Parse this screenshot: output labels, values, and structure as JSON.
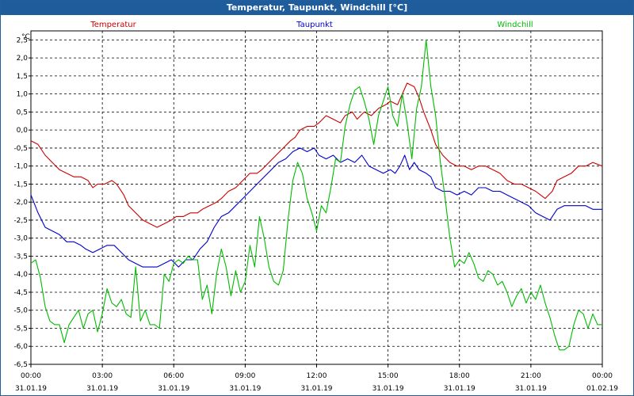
{
  "window": {
    "title": "Temperatur, Taupunkt, Windchill [°C]"
  },
  "chart_data": {
    "type": "line",
    "title": "Temperatur, Taupunkt, Windchill [°C]",
    "ylabel": "°C",
    "xlabel": "",
    "ylim": [
      -6.5,
      2.75
    ],
    "xlim": [
      0,
      24
    ],
    "yticks": [
      2.5,
      2.0,
      1.5,
      1.0,
      0.5,
      0.0,
      -0.5,
      -1.0,
      -1.5,
      -2.0,
      -2.5,
      -3.0,
      -3.5,
      -4.0,
      -4.5,
      -5.0,
      -5.5,
      -6.0,
      -6.5
    ],
    "ytick_labels": [
      "2,5",
      "2,0",
      "1,5",
      "1,0",
      "0,5",
      "0,0",
      "-0,5",
      "-1,0",
      "-1,5",
      "-2,0",
      "-2,5",
      "-3,0",
      "-3,5",
      "-4,0",
      "-4,5",
      "-5,0",
      "-5,5",
      "-6,0",
      "-6,5"
    ],
    "xticks": [
      {
        "time": "00:00",
        "date": "31.01.19"
      },
      {
        "time": "03:00",
        "date": "31.01.19"
      },
      {
        "time": "06:00",
        "date": "31.01.19"
      },
      {
        "time": "09:00",
        "date": "31.01.19"
      },
      {
        "time": "12:00",
        "date": "31.01.19"
      },
      {
        "time": "15:00",
        "date": "31.01.19"
      },
      {
        "time": "18:00",
        "date": "31.01.19"
      },
      {
        "time": "21:00",
        "date": "31.01.19"
      },
      {
        "time": "00:00",
        "date": "01.02.19"
      }
    ],
    "grid": true,
    "legend_position": "top",
    "series": [
      {
        "name": "Temperatur",
        "color": "#cc0000",
        "points": [
          [
            0.0,
            -0.3
          ],
          [
            0.3,
            -0.4
          ],
          [
            0.6,
            -0.7
          ],
          [
            0.9,
            -0.9
          ],
          [
            1.2,
            -1.1
          ],
          [
            1.5,
            -1.2
          ],
          [
            1.8,
            -1.3
          ],
          [
            2.1,
            -1.3
          ],
          [
            2.4,
            -1.4
          ],
          [
            2.6,
            -1.6
          ],
          [
            2.8,
            -1.5
          ],
          [
            3.1,
            -1.5
          ],
          [
            3.4,
            -1.4
          ],
          [
            3.6,
            -1.5
          ],
          [
            3.9,
            -1.8
          ],
          [
            4.1,
            -2.1
          ],
          [
            4.4,
            -2.3
          ],
          [
            4.7,
            -2.5
          ],
          [
            5.0,
            -2.6
          ],
          [
            5.3,
            -2.7
          ],
          [
            5.6,
            -2.6
          ],
          [
            5.9,
            -2.5
          ],
          [
            6.1,
            -2.4
          ],
          [
            6.4,
            -2.4
          ],
          [
            6.7,
            -2.3
          ],
          [
            7.0,
            -2.3
          ],
          [
            7.2,
            -2.2
          ],
          [
            7.5,
            -2.1
          ],
          [
            7.8,
            -2.0
          ],
          [
            8.0,
            -1.9
          ],
          [
            8.3,
            -1.7
          ],
          [
            8.6,
            -1.6
          ],
          [
            8.9,
            -1.4
          ],
          [
            9.2,
            -1.2
          ],
          [
            9.5,
            -1.2
          ],
          [
            9.7,
            -1.1
          ],
          [
            10.0,
            -0.9
          ],
          [
            10.3,
            -0.7
          ],
          [
            10.6,
            -0.5
          ],
          [
            10.9,
            -0.3
          ],
          [
            11.1,
            -0.2
          ],
          [
            11.3,
            0.0
          ],
          [
            11.6,
            0.1
          ],
          [
            11.9,
            0.1
          ],
          [
            12.1,
            0.2
          ],
          [
            12.4,
            0.4
          ],
          [
            12.7,
            0.3
          ],
          [
            13.0,
            0.2
          ],
          [
            13.2,
            0.4
          ],
          [
            13.5,
            0.5
          ],
          [
            13.7,
            0.3
          ],
          [
            14.0,
            0.5
          ],
          [
            14.3,
            0.4
          ],
          [
            14.6,
            0.6
          ],
          [
            14.9,
            0.7
          ],
          [
            15.1,
            0.8
          ],
          [
            15.4,
            0.7
          ],
          [
            15.6,
            1.0
          ],
          [
            15.8,
            1.3
          ],
          [
            16.1,
            1.2
          ],
          [
            16.3,
            0.9
          ],
          [
            16.5,
            0.5
          ],
          [
            16.8,
            0.0
          ],
          [
            17.0,
            -0.4
          ],
          [
            17.3,
            -0.7
          ],
          [
            17.6,
            -0.9
          ],
          [
            17.9,
            -1.0
          ],
          [
            18.2,
            -1.0
          ],
          [
            18.5,
            -1.1
          ],
          [
            18.8,
            -1.0
          ],
          [
            19.1,
            -1.0
          ],
          [
            19.4,
            -1.1
          ],
          [
            19.7,
            -1.2
          ],
          [
            20.0,
            -1.4
          ],
          [
            20.3,
            -1.5
          ],
          [
            20.6,
            -1.5
          ],
          [
            20.9,
            -1.6
          ],
          [
            21.2,
            -1.7
          ],
          [
            21.4,
            -1.8
          ],
          [
            21.6,
            -1.9
          ],
          [
            21.9,
            -1.7
          ],
          [
            22.1,
            -1.4
          ],
          [
            22.4,
            -1.3
          ],
          [
            22.7,
            -1.2
          ],
          [
            23.0,
            -1.0
          ],
          [
            23.3,
            -1.0
          ],
          [
            23.6,
            -0.9
          ],
          [
            24.0,
            -1.0
          ]
        ]
      },
      {
        "name": "Taupunkt",
        "color": "#0000cc",
        "points": [
          [
            0.0,
            -1.8
          ],
          [
            0.3,
            -2.3
          ],
          [
            0.6,
            -2.7
          ],
          [
            0.9,
            -2.8
          ],
          [
            1.2,
            -2.9
          ],
          [
            1.5,
            -3.1
          ],
          [
            1.8,
            -3.1
          ],
          [
            2.1,
            -3.2
          ],
          [
            2.3,
            -3.3
          ],
          [
            2.6,
            -3.4
          ],
          [
            2.9,
            -3.3
          ],
          [
            3.2,
            -3.2
          ],
          [
            3.5,
            -3.2
          ],
          [
            3.8,
            -3.4
          ],
          [
            4.1,
            -3.6
          ],
          [
            4.4,
            -3.7
          ],
          [
            4.7,
            -3.8
          ],
          [
            5.0,
            -3.8
          ],
          [
            5.3,
            -3.8
          ],
          [
            5.6,
            -3.7
          ],
          [
            5.9,
            -3.6
          ],
          [
            6.2,
            -3.8
          ],
          [
            6.5,
            -3.6
          ],
          [
            6.8,
            -3.6
          ],
          [
            7.1,
            -3.3
          ],
          [
            7.4,
            -3.1
          ],
          [
            7.7,
            -2.7
          ],
          [
            8.0,
            -2.4
          ],
          [
            8.3,
            -2.3
          ],
          [
            8.6,
            -2.1
          ],
          [
            8.9,
            -1.9
          ],
          [
            9.2,
            -1.7
          ],
          [
            9.5,
            -1.5
          ],
          [
            9.8,
            -1.3
          ],
          [
            10.1,
            -1.1
          ],
          [
            10.4,
            -0.9
          ],
          [
            10.7,
            -0.8
          ],
          [
            11.0,
            -0.6
          ],
          [
            11.3,
            -0.5
          ],
          [
            11.6,
            -0.6
          ],
          [
            11.9,
            -0.5
          ],
          [
            12.1,
            -0.7
          ],
          [
            12.4,
            -0.8
          ],
          [
            12.7,
            -0.7
          ],
          [
            13.0,
            -0.9
          ],
          [
            13.3,
            -0.8
          ],
          [
            13.6,
            -0.9
          ],
          [
            13.9,
            -0.7
          ],
          [
            14.2,
            -1.0
          ],
          [
            14.5,
            -1.1
          ],
          [
            14.8,
            -1.2
          ],
          [
            15.1,
            -1.1
          ],
          [
            15.3,
            -1.2
          ],
          [
            15.5,
            -1.0
          ],
          [
            15.7,
            -0.7
          ],
          [
            15.9,
            -1.1
          ],
          [
            16.1,
            -0.9
          ],
          [
            16.3,
            -1.1
          ],
          [
            16.6,
            -1.2
          ],
          [
            16.8,
            -1.3
          ],
          [
            17.0,
            -1.6
          ],
          [
            17.3,
            -1.7
          ],
          [
            17.6,
            -1.7
          ],
          [
            17.9,
            -1.8
          ],
          [
            18.2,
            -1.7
          ],
          [
            18.5,
            -1.8
          ],
          [
            18.8,
            -1.6
          ],
          [
            19.1,
            -1.6
          ],
          [
            19.4,
            -1.7
          ],
          [
            19.7,
            -1.7
          ],
          [
            20.0,
            -1.8
          ],
          [
            20.3,
            -1.9
          ],
          [
            20.6,
            -2.0
          ],
          [
            20.9,
            -2.1
          ],
          [
            21.2,
            -2.3
          ],
          [
            21.5,
            -2.4
          ],
          [
            21.8,
            -2.5
          ],
          [
            22.1,
            -2.2
          ],
          [
            22.4,
            -2.1
          ],
          [
            22.7,
            -2.1
          ],
          [
            23.0,
            -2.1
          ],
          [
            23.3,
            -2.1
          ],
          [
            23.6,
            -2.2
          ],
          [
            24.0,
            -2.2
          ]
        ]
      },
      {
        "name": "Windchill",
        "color": "#00bb00",
        "points": [
          [
            0.0,
            -3.7
          ],
          [
            0.2,
            -3.6
          ],
          [
            0.4,
            -4.1
          ],
          [
            0.6,
            -4.9
          ],
          [
            0.8,
            -5.3
          ],
          [
            1.0,
            -5.4
          ],
          [
            1.2,
            -5.4
          ],
          [
            1.4,
            -5.9
          ],
          [
            1.6,
            -5.4
          ],
          [
            1.8,
            -5.2
          ],
          [
            2.0,
            -5.0
          ],
          [
            2.2,
            -5.5
          ],
          [
            2.4,
            -5.1
          ],
          [
            2.6,
            -5.0
          ],
          [
            2.8,
            -5.6
          ],
          [
            3.0,
            -5.1
          ],
          [
            3.2,
            -4.4
          ],
          [
            3.4,
            -4.8
          ],
          [
            3.6,
            -4.9
          ],
          [
            3.8,
            -4.7
          ],
          [
            4.0,
            -5.1
          ],
          [
            4.2,
            -5.2
          ],
          [
            4.4,
            -3.8
          ],
          [
            4.6,
            -5.3
          ],
          [
            4.8,
            -5.0
          ],
          [
            5.0,
            -5.4
          ],
          [
            5.2,
            -5.4
          ],
          [
            5.4,
            -5.5
          ],
          [
            5.6,
            -4.0
          ],
          [
            5.8,
            -4.2
          ],
          [
            6.0,
            -3.7
          ],
          [
            6.2,
            -3.6
          ],
          [
            6.4,
            -3.7
          ],
          [
            6.6,
            -3.5
          ],
          [
            6.8,
            -3.6
          ],
          [
            7.0,
            -3.6
          ],
          [
            7.2,
            -4.7
          ],
          [
            7.4,
            -4.3
          ],
          [
            7.6,
            -5.1
          ],
          [
            7.8,
            -4.0
          ],
          [
            8.0,
            -3.3
          ],
          [
            8.2,
            -3.8
          ],
          [
            8.4,
            -4.6
          ],
          [
            8.6,
            -3.9
          ],
          [
            8.8,
            -4.5
          ],
          [
            9.0,
            -4.2
          ],
          [
            9.2,
            -3.2
          ],
          [
            9.4,
            -3.8
          ],
          [
            9.6,
            -2.4
          ],
          [
            9.8,
            -3.0
          ],
          [
            10.0,
            -3.8
          ],
          [
            10.2,
            -4.2
          ],
          [
            10.4,
            -4.3
          ],
          [
            10.6,
            -3.9
          ],
          [
            10.8,
            -2.5
          ],
          [
            11.0,
            -1.4
          ],
          [
            11.2,
            -0.9
          ],
          [
            11.4,
            -1.2
          ],
          [
            11.6,
            -1.9
          ],
          [
            11.8,
            -2.3
          ],
          [
            12.0,
            -2.8
          ],
          [
            12.2,
            -2.1
          ],
          [
            12.4,
            -2.3
          ],
          [
            12.6,
            -1.6
          ],
          [
            12.8,
            -0.8
          ],
          [
            13.0,
            -0.9
          ],
          [
            13.2,
            0.1
          ],
          [
            13.4,
            0.7
          ],
          [
            13.6,
            1.1
          ],
          [
            13.8,
            1.2
          ],
          [
            14.0,
            0.8
          ],
          [
            14.2,
            0.3
          ],
          [
            14.4,
            -0.4
          ],
          [
            14.6,
            0.4
          ],
          [
            14.8,
            0.8
          ],
          [
            15.0,
            1.2
          ],
          [
            15.2,
            0.4
          ],
          [
            15.4,
            0.1
          ],
          [
            15.6,
            1.0
          ],
          [
            15.8,
            0.2
          ],
          [
            16.0,
            -0.8
          ],
          [
            16.2,
            0.6
          ],
          [
            16.4,
            1.2
          ],
          [
            16.6,
            2.5
          ],
          [
            16.8,
            1.2
          ],
          [
            17.0,
            0.4
          ],
          [
            17.2,
            -0.9
          ],
          [
            17.4,
            -1.9
          ],
          [
            17.6,
            -3.0
          ],
          [
            17.8,
            -3.8
          ],
          [
            18.0,
            -3.6
          ],
          [
            18.2,
            -3.7
          ],
          [
            18.4,
            -3.4
          ],
          [
            18.6,
            -3.7
          ],
          [
            18.8,
            -4.1
          ],
          [
            19.0,
            -4.2
          ],
          [
            19.2,
            -3.9
          ],
          [
            19.4,
            -4.0
          ],
          [
            19.6,
            -4.3
          ],
          [
            19.8,
            -4.2
          ],
          [
            20.0,
            -4.5
          ],
          [
            20.2,
            -4.9
          ],
          [
            20.4,
            -4.6
          ],
          [
            20.6,
            -4.4
          ],
          [
            20.8,
            -4.8
          ],
          [
            21.0,
            -4.5
          ],
          [
            21.2,
            -4.7
          ],
          [
            21.4,
            -4.3
          ],
          [
            21.6,
            -4.8
          ],
          [
            21.8,
            -5.2
          ],
          [
            22.0,
            -5.7
          ],
          [
            22.2,
            -6.1
          ],
          [
            22.4,
            -6.1
          ],
          [
            22.6,
            -6.0
          ],
          [
            22.8,
            -5.4
          ],
          [
            23.0,
            -5.0
          ],
          [
            23.2,
            -5.1
          ],
          [
            23.4,
            -5.5
          ],
          [
            23.6,
            -5.1
          ],
          [
            23.8,
            -5.4
          ],
          [
            24.0,
            -5.4
          ]
        ]
      }
    ]
  }
}
